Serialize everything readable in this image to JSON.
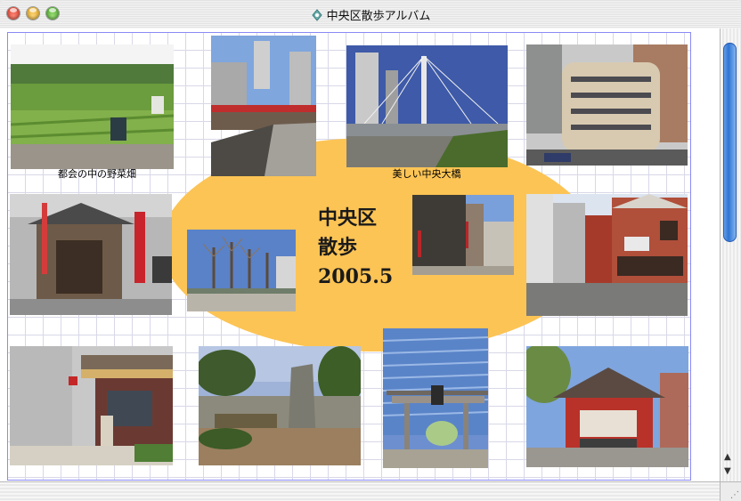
{
  "window": {
    "title": "中央区散歩アルバム"
  },
  "canvas": {
    "title_lines": [
      "中央区",
      "散歩",
      "2005.5"
    ],
    "accent_color": "#fcc455",
    "grid_color": "#d8d8e8"
  },
  "captions": {
    "vegetable_field": "都会の中の野菜畑",
    "chuo_bridge": "美しい中央大橋"
  },
  "scrollbar": {
    "up_arrow": "▲",
    "down_arrow": "▼",
    "grip": "⋰"
  },
  "photos": [
    {
      "name": "photo-vegetable-field"
    },
    {
      "name": "photo-river-bridge-red"
    },
    {
      "name": "photo-chuo-bridge"
    },
    {
      "name": "photo-corner-building"
    },
    {
      "name": "photo-shrine-street"
    },
    {
      "name": "photo-park-trees"
    },
    {
      "name": "photo-city-street"
    },
    {
      "name": "photo-red-brick-corner"
    },
    {
      "name": "photo-old-shop-street"
    },
    {
      "name": "photo-stone-monument"
    },
    {
      "name": "photo-torii-tower"
    },
    {
      "name": "photo-red-shrine"
    }
  ]
}
